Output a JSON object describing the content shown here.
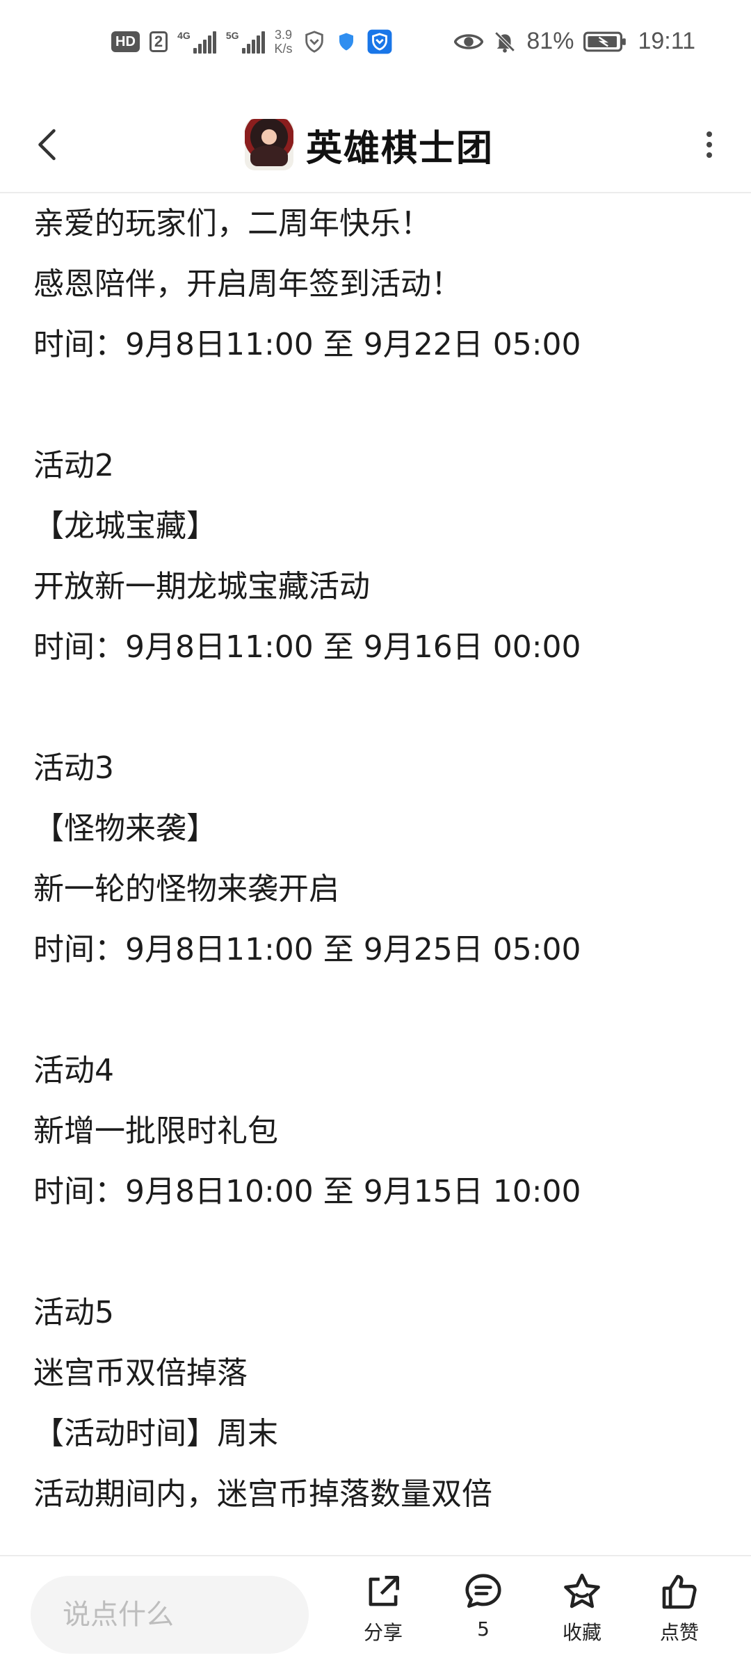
{
  "status_bar": {
    "hd": "HD",
    "hd_num": "2",
    "net1": "4G",
    "net2": "5G",
    "speed_value": "3.9",
    "speed_unit": "K/s",
    "battery": "81%",
    "time": "19:11"
  },
  "header": {
    "title": "英雄棋士团"
  },
  "content": {
    "lines": [
      "亲爱的玩家们，二周年快乐！",
      "感恩陪伴，开启周年签到活动！",
      "时间：9月8日11:00 至 9月22日 05:00",
      "",
      "活动2",
      "【龙城宝藏】",
      "开放新一期龙城宝藏活动",
      "时间：9月8日11:00 至 9月16日 00:00",
      "",
      "活动3",
      "【怪物来袭】",
      "新一轮的怪物来袭开启",
      "时间：9月8日11:00 至 9月25日 05:00",
      "",
      "活动4",
      "新增一批限时礼包",
      "时间：9月8日10:00 至 9月15日 10:00",
      "",
      "活动5",
      "迷宫币双倍掉落",
      "【活动时间】周末",
      "活动期间内，迷宫币掉落数量双倍"
    ]
  },
  "bottom_bar": {
    "comment_placeholder": "说点什么",
    "share_label": "分享",
    "comment_count": "5",
    "favorite_label": "收藏",
    "like_label": "点赞"
  }
}
